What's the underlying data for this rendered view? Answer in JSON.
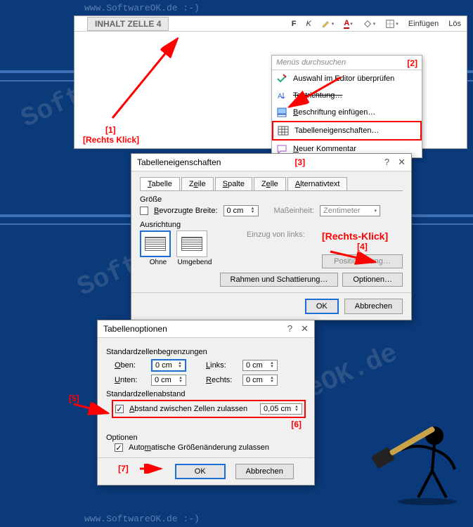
{
  "watermarks": {
    "url": "www.SoftwareOK.de :-)",
    "diag": "SoftwareOK.de"
  },
  "wordTop": {
    "cellContent": "INHALT ZELLE 4",
    "toolbarInsert": "Einfügen",
    "toolbarDelete": "Lös"
  },
  "contextMenu": {
    "searchPlaceholder": "Menüs durchsuchen",
    "items": [
      {
        "label": "Auswahl im Editor überprüfen",
        "icon": "check-pencil"
      },
      {
        "label": "Textrichtung…",
        "icon": "text-direction",
        "strike": true
      },
      {
        "label": "Beschriftung einfügen…",
        "icon": "caption"
      },
      {
        "label": "Tabelleneigenschaften…",
        "icon": "table",
        "highlight": true
      },
      {
        "label": "Neuer Kommentar",
        "icon": "comment"
      }
    ]
  },
  "labels": {
    "l1": "[1]",
    "l2": "[2]",
    "l3": "[3]",
    "l4": "[4]",
    "l5": "[5]",
    "l6": "[6]",
    "l7": "[7]",
    "rechtsKlick": "[Rechts Klick]",
    "rechtsKlick2": "[Rechts-Klick]"
  },
  "dlg1": {
    "title": "Tabelleneigenschaften",
    "tabs": [
      "Tabelle",
      "Zeile",
      "Spalte",
      "Zelle",
      "Alternativtext"
    ],
    "sizeLabel": "Größe",
    "prefWidth": "Bevorzugte Breite:",
    "widthVal": "0 cm",
    "unitLabel": "Maßeinheit:",
    "unitVal": "Zentimeter",
    "alignLabel": "Ausrichtung",
    "indentLabel": "Einzug von links:",
    "alignOhne": "Ohne",
    "alignUmgebend": "Umgebend",
    "position": "Positionierung…",
    "borders": "Rahmen und Schattierung…",
    "options": "Optionen…",
    "ok": "OK",
    "cancel": "Abbrechen"
  },
  "dlg2": {
    "title": "Tabellenoptionen",
    "marginLabel": "Standardzellenbegrenzungen",
    "top": "Oben:",
    "bottom": "Unten:",
    "left": "Links:",
    "right": "Rechts:",
    "topVal": "0 cm",
    "bottomVal": "0 cm",
    "leftVal": "0 cm",
    "rightVal": "0 cm",
    "spacingLabel": "Standardzellenabstand",
    "allowSpacing": "Abstand zwischen Zellen zulassen",
    "spacingVal": "0,05 cm",
    "optionsLabel": "Optionen",
    "autoResize": "Automatische Größenänderung zulassen",
    "ok": "OK",
    "cancel": "Abbrechen"
  }
}
